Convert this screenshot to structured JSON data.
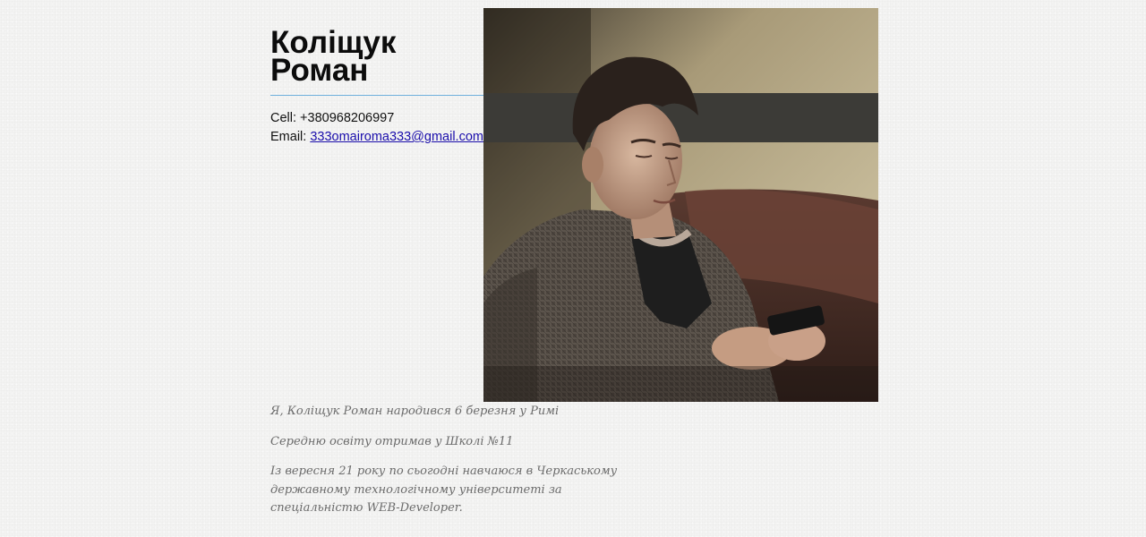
{
  "profile": {
    "name_line1": "Коліщук",
    "name_line2": "Роман",
    "cell_label": "Cell:",
    "cell_value": "+380968206997",
    "email_label": "Email:",
    "email_value": "333omairoma333@gmail.com"
  },
  "photo": {
    "icon": "portrait-photo"
  },
  "bio": {
    "paragraphs": [
      "Я, Коліщук Роман народився 6 березня у Римі",
      "Середню освіту отримав у Школі №11",
      "Із вересня 21 року по сьогодні навчаюся в Черкаському державному технологічному університеті за спеціальністю WEB-Developer."
    ]
  },
  "colors": {
    "background": "#f3f3f2",
    "divider": "#6fb0dc",
    "link": "#1a0dab",
    "bio_text": "#6b6b6b"
  }
}
